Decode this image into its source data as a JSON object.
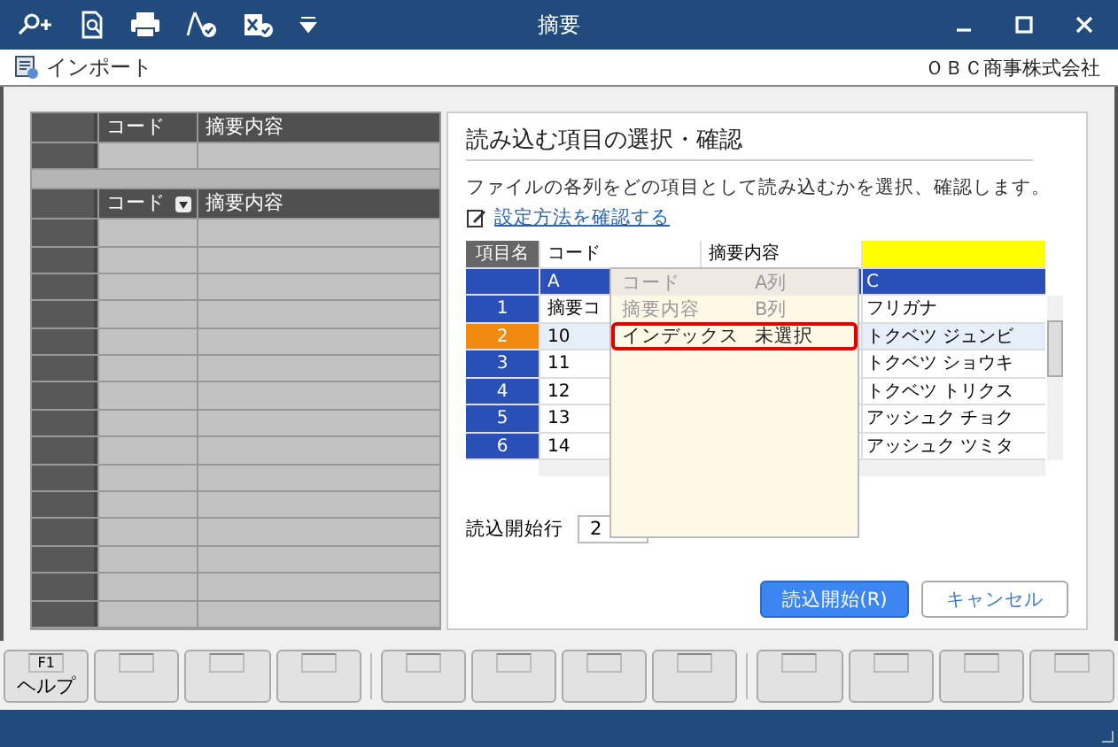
{
  "window": {
    "title": "摘要"
  },
  "toolbar": {
    "import_label": "インポート",
    "company": "ＯＢＣ商事株式会社"
  },
  "left_grid": {
    "upper_columns": [
      "コード",
      "摘要内容"
    ],
    "lower_columns": [
      "コード",
      "摘要内容"
    ]
  },
  "panel": {
    "title": "読み込む項目の選択・確認",
    "description": "ファイルの各列をどの項目として読み込むかを選択、確認します。",
    "help_link": "設定方法を確認する"
  },
  "mapping_table": {
    "corner": "項目名",
    "columns": [
      {
        "field": "コード",
        "letter": "A",
        "highlighted": false
      },
      {
        "field": "摘要内容",
        "highlighted": false
      },
      {
        "letter": "C",
        "highlighted": true
      }
    ],
    "rows": [
      {
        "number": "1",
        "selected": false,
        "cells": [
          "摘要コ",
          "フリガナ"
        ]
      },
      {
        "number": "2",
        "selected": true,
        "cells": [
          "10",
          "トクベツ ジュンビ"
        ]
      },
      {
        "number": "3",
        "selected": false,
        "cells": [
          "11",
          "トクベツ ショウキ"
        ]
      },
      {
        "number": "4",
        "selected": false,
        "cells": [
          "12",
          "トクベツ トリクス"
        ]
      },
      {
        "number": "5",
        "selected": false,
        "cells": [
          "13",
          "アッシュク チョク"
        ]
      },
      {
        "number": "6",
        "selected": false,
        "cells": [
          "14",
          "アッシュク ツミタ"
        ]
      }
    ]
  },
  "dropdown": [
    {
      "label": "コード",
      "column": "A列",
      "disabled": true,
      "selected": false
    },
    {
      "label": "摘要内容",
      "column": "B列",
      "disabled": true,
      "selected": false
    },
    {
      "label": "インデックス",
      "column": "未選択",
      "disabled": false,
      "selected": true
    }
  ],
  "start_row": {
    "label": "読込開始行",
    "value": "2"
  },
  "buttons": {
    "primary": "読込開始(R)",
    "cancel": "キャンセル"
  },
  "function_keys": [
    {
      "key": "F1",
      "label": "ヘルプ"
    }
  ]
}
